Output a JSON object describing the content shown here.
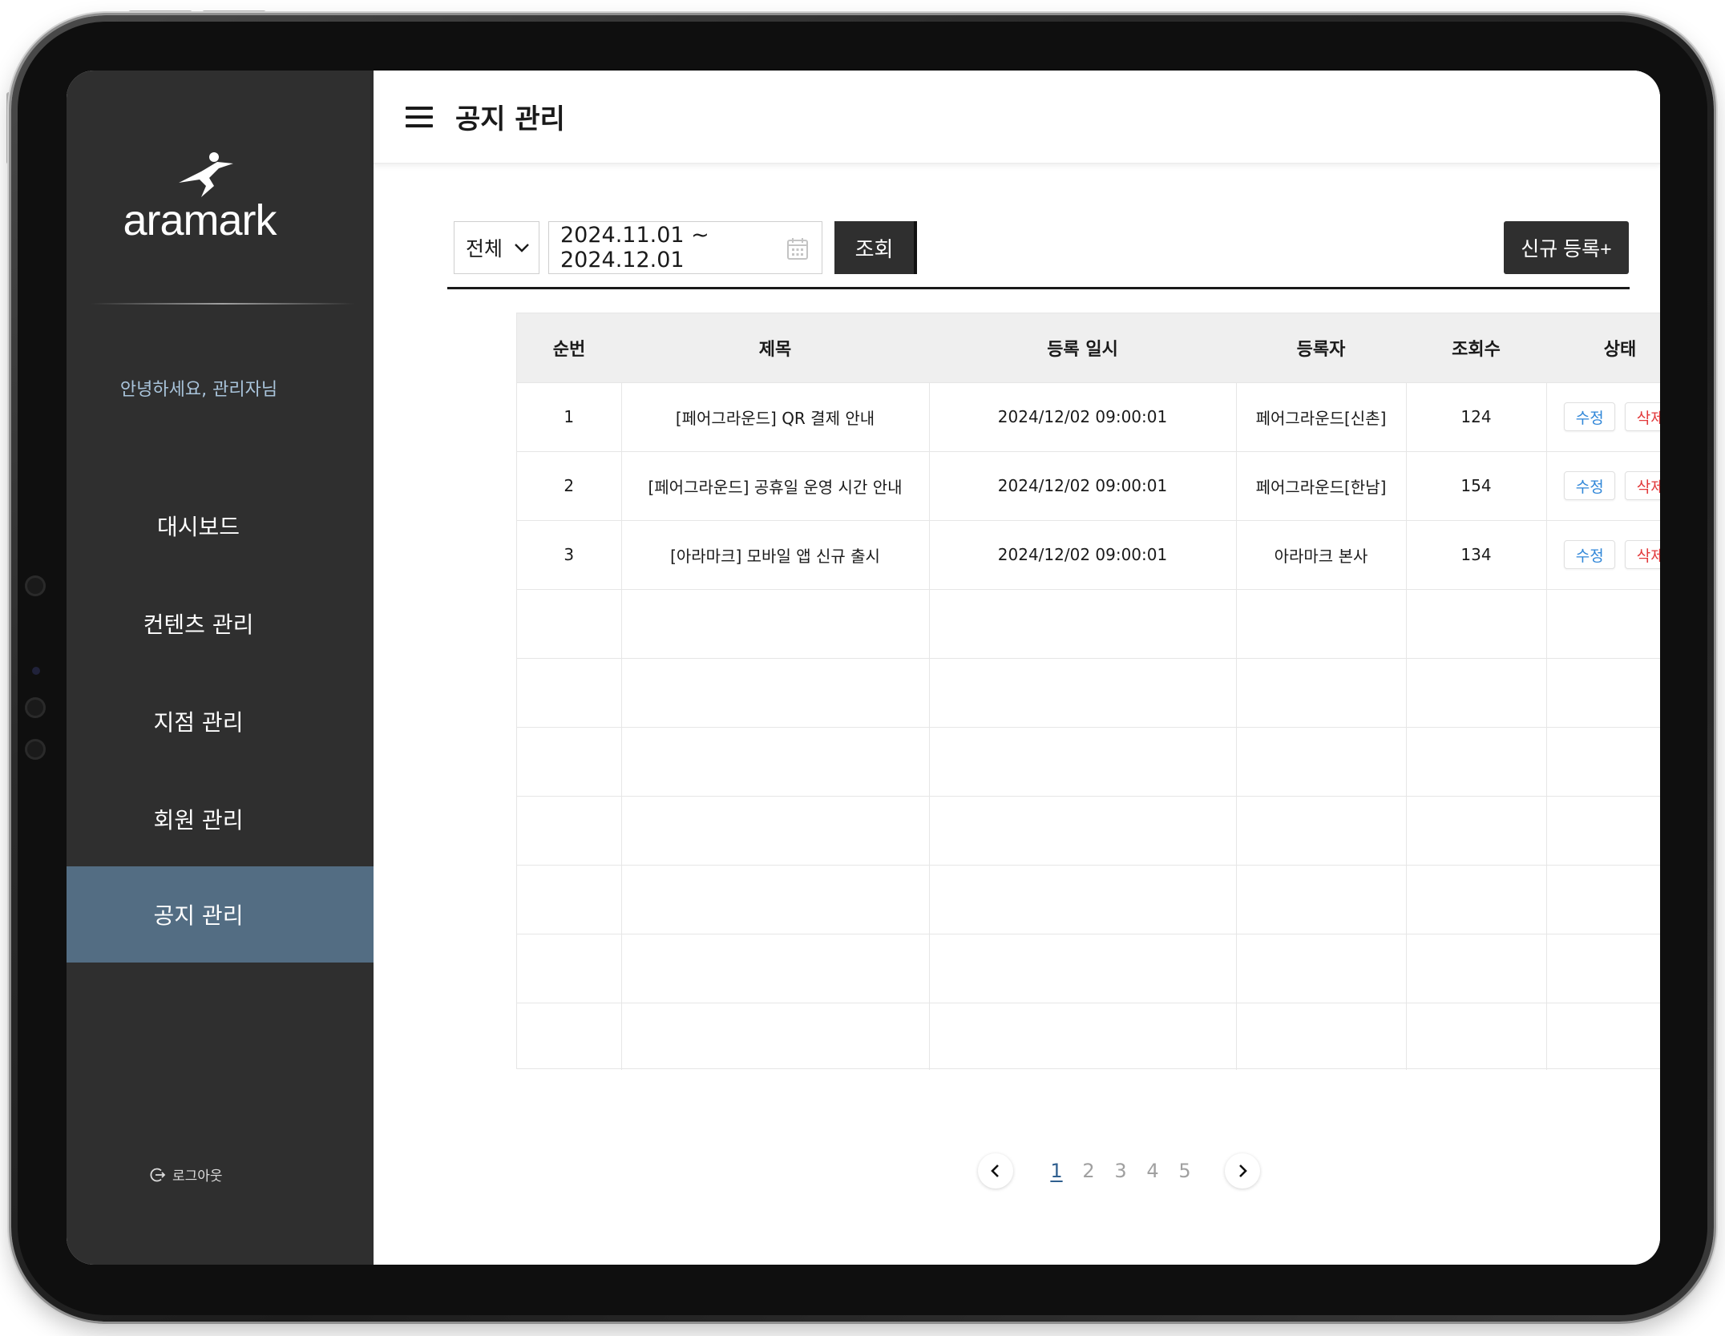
{
  "brand": {
    "name": "aramark"
  },
  "sidebar": {
    "greeting": "안녕하세요, 관리자님",
    "items": [
      {
        "label": "대시보드"
      },
      {
        "label": "컨텐츠 관리"
      },
      {
        "label": "지점 관리"
      },
      {
        "label": "회원 관리"
      },
      {
        "label": "공지 관리",
        "active": true
      }
    ],
    "logout_label": "로그아웃"
  },
  "header": {
    "title": "공지 관리"
  },
  "filters": {
    "category_selected": "전체",
    "date_range": "2024.11.01 ~ 2024.12.01",
    "search_label": "조회",
    "new_label": "신규 등록+"
  },
  "table": {
    "columns": [
      "순번",
      "제목",
      "등록 일시",
      "등록자",
      "조회수",
      "상태"
    ],
    "edit_label": "수정",
    "delete_label": "삭제",
    "rows": [
      {
        "no": "1",
        "title": "[페어그라운드] QR 결제 안내",
        "date": "2024/12/02 09:00:01",
        "author": "페어그라운드[신촌]",
        "views": "124"
      },
      {
        "no": "2",
        "title": "[페어그라운드] 공휴일 운영 시간 안내",
        "date": "2024/12/02 09:00:01",
        "author": "페어그라운드[한남]",
        "views": "154"
      },
      {
        "no": "3",
        "title": "[아라마크] 모바일 앱 신규 출시",
        "date": "2024/12/02 09:00:01",
        "author": "아라마크 본사",
        "views": "134"
      }
    ]
  },
  "pagination": {
    "pages": [
      "1",
      "2",
      "3",
      "4",
      "5"
    ],
    "current": "1"
  },
  "colors": {
    "sidebar_bg": "#2f2f2f",
    "sidebar_active": "#536d83",
    "greeting": "#a9c4db",
    "edit": "#2f86d8",
    "delete": "#e2393b",
    "current_page": "#2f5f8f"
  }
}
